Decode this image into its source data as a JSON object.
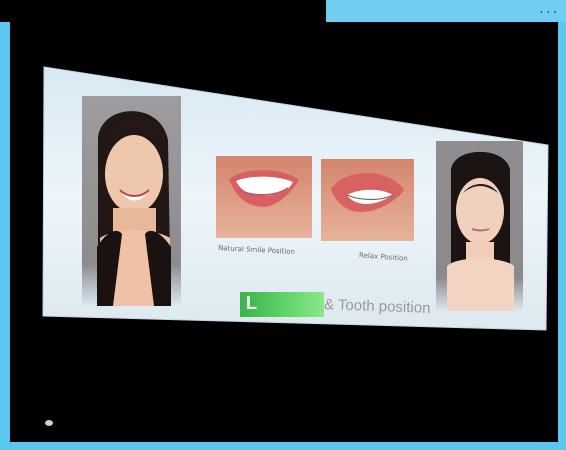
{
  "top_bar": {
    "text": "..."
  },
  "slide": {
    "caption_left": "Natural Smile Position",
    "caption_right": "Relax Position",
    "headline": "& Tooth position"
  }
}
